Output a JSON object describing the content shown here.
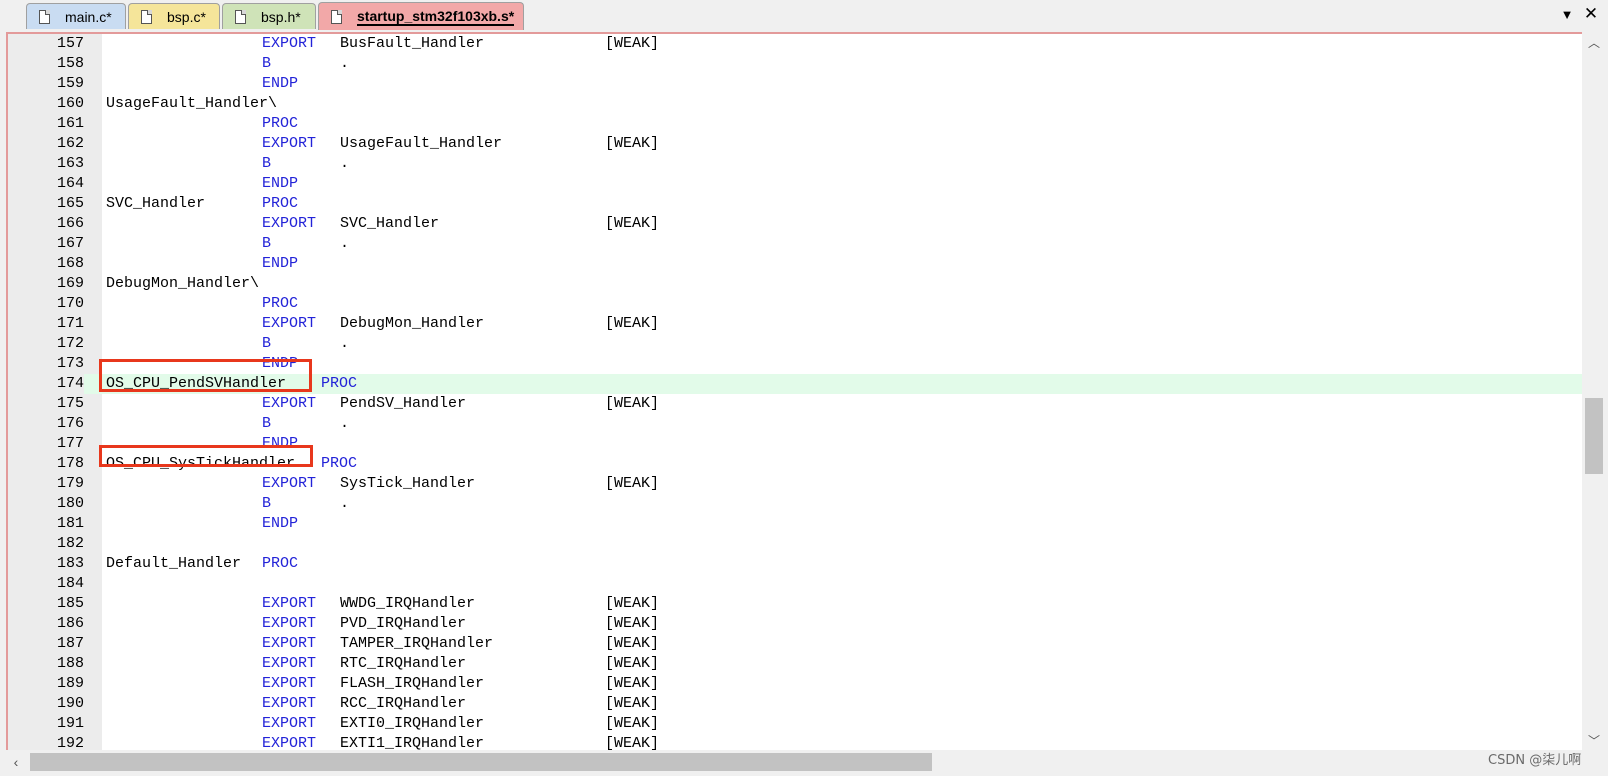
{
  "tabs": [
    {
      "label": "main.c*",
      "color": "#c9dcf2"
    },
    {
      "label": "bsp.c*",
      "color": "#f5e59a"
    },
    {
      "label": "bsp.h*",
      "color": "#cfe3b8"
    },
    {
      "label": "startup_stm32f103xb.s*",
      "color": "#f2a8a8",
      "active": true
    }
  ],
  "tab_controls": {
    "dropdown_icon": "chevron-down-icon",
    "close_icon": "close-icon"
  },
  "editor": {
    "current_line": "174",
    "highlighted_labels": [
      "OS_CPU_PendSVHandler",
      "OS_CPU_SysTickHandler"
    ],
    "lines": [
      {
        "num": "157",
        "label": "",
        "kw": "EXPORT",
        "arg": "BusFault_Handler",
        "weak": "[WEAK]"
      },
      {
        "num": "158",
        "label": "",
        "kw": "B",
        "arg": ".",
        "weak": ""
      },
      {
        "num": "159",
        "label": "",
        "kw": "ENDP",
        "arg": "",
        "weak": ""
      },
      {
        "num": "160",
        "label": "UsageFault_Handler\\",
        "kw": "",
        "arg": "",
        "weak": ""
      },
      {
        "num": "161",
        "label": "",
        "kw": "PROC",
        "arg": "",
        "weak": ""
      },
      {
        "num": "162",
        "label": "",
        "kw": "EXPORT",
        "arg": "UsageFault_Handler",
        "weak": "[WEAK]"
      },
      {
        "num": "163",
        "label": "",
        "kw": "B",
        "arg": ".",
        "weak": ""
      },
      {
        "num": "164",
        "label": "",
        "kw": "ENDP",
        "arg": "",
        "weak": ""
      },
      {
        "num": "165",
        "label": "SVC_Handler",
        "kw": "PROC",
        "arg": "",
        "weak": ""
      },
      {
        "num": "166",
        "label": "",
        "kw": "EXPORT",
        "arg": "SVC_Handler",
        "weak": "[WEAK]"
      },
      {
        "num": "167",
        "label": "",
        "kw": "B",
        "arg": ".",
        "weak": ""
      },
      {
        "num": "168",
        "label": "",
        "kw": "ENDP",
        "arg": "",
        "weak": ""
      },
      {
        "num": "169",
        "label": "DebugMon_Handler\\",
        "kw": "",
        "arg": "",
        "weak": ""
      },
      {
        "num": "170",
        "label": "",
        "kw": "PROC",
        "arg": "",
        "weak": ""
      },
      {
        "num": "171",
        "label": "",
        "kw": "EXPORT",
        "arg": "DebugMon_Handler",
        "weak": "[WEAK]"
      },
      {
        "num": "172",
        "label": "",
        "kw": "B",
        "arg": ".",
        "weak": ""
      },
      {
        "num": "173",
        "label": "",
        "kw": "ENDP",
        "arg": "",
        "weak": ""
      },
      {
        "num": "174",
        "label": "OS_CPU_PendSVHandler",
        "kw": "PROC",
        "arg": "",
        "weak": ""
      },
      {
        "num": "175",
        "label": "",
        "kw": "EXPORT",
        "arg": "PendSV_Handler",
        "weak": "[WEAK]"
      },
      {
        "num": "176",
        "label": "",
        "kw": "B",
        "arg": ".",
        "weak": ""
      },
      {
        "num": "177",
        "label": "",
        "kw": "ENDP",
        "arg": "",
        "weak": ""
      },
      {
        "num": "178",
        "label": "OS_CPU_SysTickHandler",
        "kw": "PROC",
        "arg": "",
        "weak": ""
      },
      {
        "num": "179",
        "label": "",
        "kw": "EXPORT",
        "arg": "SysTick_Handler",
        "weak": "[WEAK]"
      },
      {
        "num": "180",
        "label": "",
        "kw": "B",
        "arg": ".",
        "weak": ""
      },
      {
        "num": "181",
        "label": "",
        "kw": "ENDP",
        "arg": "",
        "weak": ""
      },
      {
        "num": "182",
        "label": "",
        "kw": "",
        "arg": "",
        "weak": ""
      },
      {
        "num": "183",
        "label": "Default_Handler",
        "kw": "PROC",
        "arg": "",
        "weak": ""
      },
      {
        "num": "184",
        "label": "",
        "kw": "",
        "arg": "",
        "weak": ""
      },
      {
        "num": "185",
        "label": "",
        "kw": "EXPORT",
        "arg": "WWDG_IRQHandler",
        "weak": "[WEAK]"
      },
      {
        "num": "186",
        "label": "",
        "kw": "EXPORT",
        "arg": "PVD_IRQHandler",
        "weak": "[WEAK]"
      },
      {
        "num": "187",
        "label": "",
        "kw": "EXPORT",
        "arg": "TAMPER_IRQHandler",
        "weak": "[WEAK]"
      },
      {
        "num": "188",
        "label": "",
        "kw": "EXPORT",
        "arg": "RTC_IRQHandler",
        "weak": "[WEAK]"
      },
      {
        "num": "189",
        "label": "",
        "kw": "EXPORT",
        "arg": "FLASH_IRQHandler",
        "weak": "[WEAK]"
      },
      {
        "num": "190",
        "label": "",
        "kw": "EXPORT",
        "arg": "RCC_IRQHandler",
        "weak": "[WEAK]"
      },
      {
        "num": "191",
        "label": "",
        "kw": "EXPORT",
        "arg": "EXTI0_IRQHandler",
        "weak": "[WEAK]"
      },
      {
        "num": "192",
        "label": "",
        "kw": "EXPORT",
        "arg": "EXTI1_IRQHandler",
        "weak": "[WEAK]"
      }
    ]
  },
  "colors": {
    "keyword": "#2323d8",
    "current_line_bg": "#e2fbe9",
    "highlight_box": "#e8371c",
    "gutter_bg": "#ececec"
  },
  "watermark": "CSDN @柒儿啊"
}
